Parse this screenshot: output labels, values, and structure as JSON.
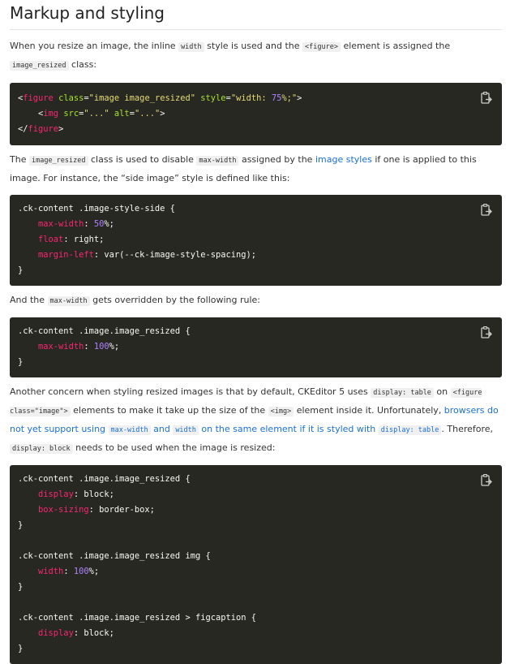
{
  "title": "Markup and styling",
  "p1": {
    "a": "When you resize an image, the inline ",
    "c1": "width",
    "b": " style is used and the ",
    "c2": "<figure>",
    "c": " element is assigned the ",
    "c3": "image_resized",
    "d": " class:"
  },
  "code1": {
    "l1": {
      "o": "<",
      "tag": "figure",
      "attr1": " class",
      "eq1": "=",
      "val1": "\"image image_resized\"",
      "attr2": " style",
      "eq2": "=",
      "val2a": "\"width: ",
      "num": "75",
      "val2b": "%;\"",
      "close": ">"
    },
    "l2": {
      "indent": "    ",
      "o": "<",
      "tag": "img",
      "attr1": " src",
      "eq1": "=",
      "val1": "\"...\"",
      "attr2": " alt",
      "eq2": "=",
      "val2": "\"...\"",
      "close": ">"
    },
    "l3": {
      "o": "</",
      "tag": "figure",
      "close": ">"
    }
  },
  "p2": {
    "a": "The ",
    "c1": "image_resized",
    "b": " class is used to disable ",
    "c2": "max-width",
    "c": " assigned by the ",
    "link": "image styles",
    "d": " if one is applied to this image. For instance, the “side image” style is defined like this:"
  },
  "code2": {
    "l1": ".ck-content .image-style-side {",
    "l2": {
      "prop": "max-width",
      "colon": ": ",
      "num": "50",
      "rest": "%;"
    },
    "l3": {
      "prop": "float",
      "colon": ": ",
      "rest": "right;"
    },
    "l4": {
      "prop": "margin-left",
      "colon": ": ",
      "rest": "var(--ck-image-style-spacing);"
    },
    "l5": "}"
  },
  "p3": {
    "a": "And the ",
    "c1": "max-width",
    "b": " gets overridden by the following rule:"
  },
  "code3": {
    "l1": ".ck-content .image.image_resized {",
    "l2": {
      "prop": "max-width",
      "colon": ": ",
      "num": "100",
      "rest": "%;"
    },
    "l3": "}"
  },
  "p4": {
    "a": "Another concern when styling resized images is that by default, CKEditor 5 uses ",
    "c1": "display: table",
    "b": " on ",
    "c2": "<figure class=\"image\">",
    "c": " elements to make it take up the size of the ",
    "c3": "<img>",
    "d": " element inside it. Unfortunately, ",
    "link1": "browsers do not yet support using ",
    "linkc1": "max-width",
    "link2": " and ",
    "linkc2": "width",
    "link3": " on the same element if it is styled with ",
    "linkc3": "display: table",
    "e": ". Therefore, ",
    "c4": "display: block",
    "f": " needs to be used when the image is resized:"
  },
  "code4": {
    "l1": ".ck-content .image.image_resized {",
    "l2": {
      "prop": "display",
      "colon": ": ",
      "rest": "block;"
    },
    "l3": {
      "prop": "box-sizing",
      "colon": ": ",
      "rest": "border-box;"
    },
    "l4": "}",
    "l6": ".ck-content .image.image_resized img {",
    "l7": {
      "prop": "width",
      "colon": ": ",
      "num": "100",
      "rest": "%;"
    },
    "l8": "}",
    "l10": ".ck-content .image.image_resized > figcaption {",
    "l11": {
      "prop": "display",
      "colon": ": ",
      "rest": "block;"
    },
    "l12": "}"
  },
  "icons": {
    "copy": "copy-to-clipboard-icon"
  }
}
